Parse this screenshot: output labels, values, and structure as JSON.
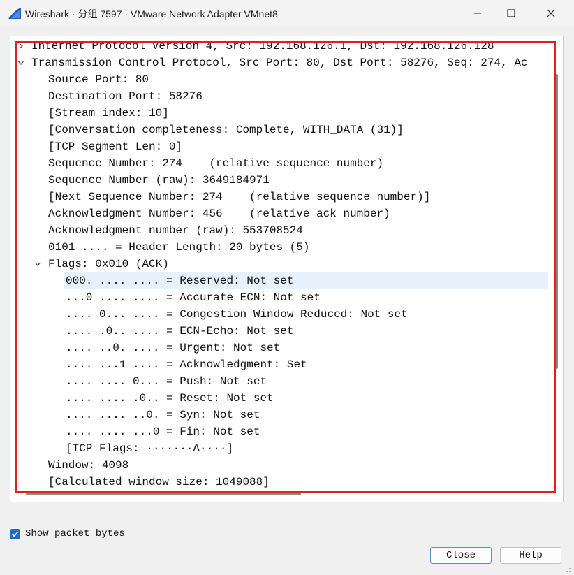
{
  "window": {
    "title": "Wireshark · 分组 7597 · VMware Network Adapter VMnet8",
    "minimize_icon": "minimize-icon",
    "maximize_icon": "maximize-icon",
    "close_icon": "close-icon"
  },
  "tree": {
    "rows": [
      {
        "text": "Internet Protocol Version 4, Src: 192.168.126.1, Dst: 192.168.126.128",
        "level": 0,
        "expander": "collapsed"
      },
      {
        "text": "Transmission Control Protocol, Src Port: 80, Dst Port: 58276, Seq: 274, Ac",
        "level": 0,
        "expander": "expanded"
      },
      {
        "text": "Source Port: 80",
        "level": 1,
        "expander": "none"
      },
      {
        "text": "Destination Port: 58276",
        "level": 1,
        "expander": "none"
      },
      {
        "text": "[Stream index: 10]",
        "level": 1,
        "expander": "none"
      },
      {
        "text": "[Conversation completeness: Complete, WITH_DATA (31)]",
        "level": 1,
        "expander": "none"
      },
      {
        "text": "[TCP Segment Len: 0]",
        "level": 1,
        "expander": "none"
      },
      {
        "text": "Sequence Number: 274    (relative sequence number)",
        "level": 1,
        "expander": "none"
      },
      {
        "text": "Sequence Number (raw): 3649184971",
        "level": 1,
        "expander": "none"
      },
      {
        "text": "[Next Sequence Number: 274    (relative sequence number)]",
        "level": 1,
        "expander": "none"
      },
      {
        "text": "Acknowledgment Number: 456    (relative ack number)",
        "level": 1,
        "expander": "none"
      },
      {
        "text": "Acknowledgment number (raw): 553708524",
        "level": 1,
        "expander": "none"
      },
      {
        "text": "0101 .... = Header Length: 20 bytes (5)",
        "level": 1,
        "expander": "none"
      },
      {
        "text": "Flags: 0x010 (ACK)",
        "level": 1,
        "expander": "expanded"
      },
      {
        "text": "000. .... .... = Reserved: Not set",
        "level": 2,
        "expander": "none",
        "selected": true
      },
      {
        "text": "...0 .... .... = Accurate ECN: Not set",
        "level": 2,
        "expander": "none"
      },
      {
        "text": ".... 0... .... = Congestion Window Reduced: Not set",
        "level": 2,
        "expander": "none"
      },
      {
        "text": ".... .0.. .... = ECN-Echo: Not set",
        "level": 2,
        "expander": "none"
      },
      {
        "text": ".... ..0. .... = Urgent: Not set",
        "level": 2,
        "expander": "none"
      },
      {
        "text": ".... ...1 .... = Acknowledgment: Set",
        "level": 2,
        "expander": "none"
      },
      {
        "text": ".... .... 0... = Push: Not set",
        "level": 2,
        "expander": "none"
      },
      {
        "text": ".... .... .0.. = Reset: Not set",
        "level": 2,
        "expander": "none"
      },
      {
        "text": ".... .... ..0. = Syn: Not set",
        "level": 2,
        "expander": "none"
      },
      {
        "text": ".... .... ...0 = Fin: Not set",
        "level": 2,
        "expander": "none"
      },
      {
        "text": "[TCP Flags: ·······A····]",
        "level": 2,
        "expander": "none"
      },
      {
        "text": "Window: 4098",
        "level": 1,
        "expander": "none"
      },
      {
        "text": "[Calculated window size: 1049088]",
        "level": 1,
        "expander": "none"
      }
    ]
  },
  "footer": {
    "show_bytes_label": "Show packet bytes",
    "show_bytes_checked": true,
    "close_label": "Close",
    "help_label": "Help"
  },
  "colors": {
    "highlight_border": "#e02020",
    "selected_row": "#e6f1fb",
    "checkbox": "#1f6fc0"
  }
}
